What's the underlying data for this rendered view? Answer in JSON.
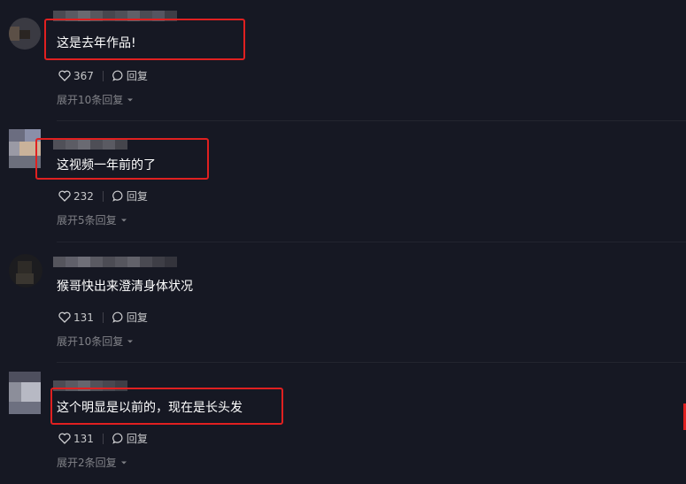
{
  "comments": [
    {
      "text": "这是去年作品!",
      "likes": "367",
      "reply_label": "回复",
      "expand_label": "展开10条回复"
    },
    {
      "text": "这视频一年前的了",
      "likes": "232",
      "reply_label": "回复",
      "expand_label": "展开5条回复"
    },
    {
      "text": "猴哥快出来澄清身体状况",
      "likes": "131",
      "reply_label": "回复",
      "expand_label": "展开10条回复"
    },
    {
      "text": "这个明显是以前的，现在是长头发",
      "likes": "131",
      "reply_label": "回复",
      "expand_label": "展开2条回复"
    }
  ],
  "icons": {
    "like": "heart-outline-icon",
    "reply": "speech-bubble-icon",
    "expand": "caret-down-icon"
  },
  "colors": {
    "background": "#161823",
    "highlight_box": "#e02020"
  }
}
